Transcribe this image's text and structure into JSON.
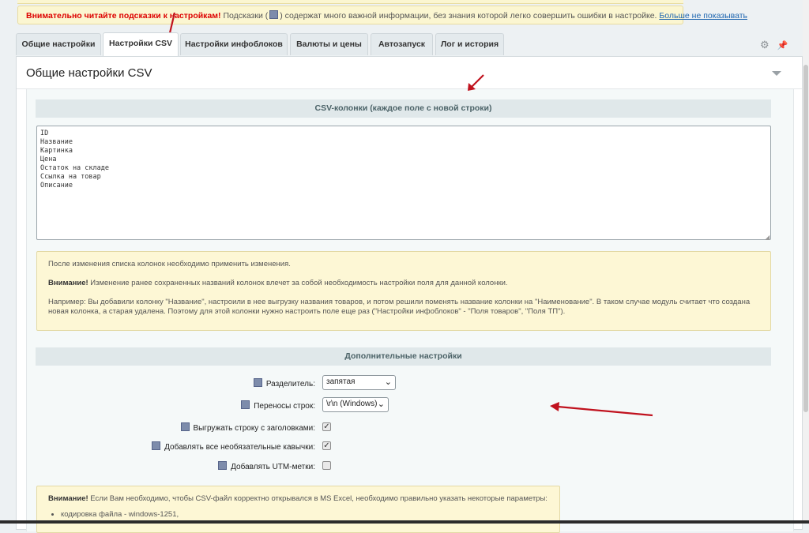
{
  "hint_banner": {
    "warning": "Внимательно читайте подсказки к настройкам!",
    "text_before_icon": "Подсказки (",
    "text_after_icon": ") содержат много важной информации, без знания которой легко совершить ошибки в настройке.",
    "link": "Больше не показывать"
  },
  "tabs": [
    {
      "label": "Общие настройки"
    },
    {
      "label": "Настройки CSV"
    },
    {
      "label": "Настройки инфоблоков"
    },
    {
      "label": "Валюты и цены"
    },
    {
      "label": "Автозапуск"
    },
    {
      "label": "Лог и история"
    }
  ],
  "tab_tools": {
    "settings_icon": "gear-icon",
    "pin_icon": "pin-icon"
  },
  "panel": {
    "title": "Общие настройки CSV",
    "csv_section_title": "CSV-колонки (каждое поле с новой строки)",
    "csv_columns": "ID\nНазвание\nКартинка\nЦена\nОстаток на складе\nСсылка на товар\nОписание",
    "note1": {
      "p1": "После изменения списка колонок необходимо применить изменения.",
      "p2_bold": "Внимание!",
      "p2": " Изменение ранее сохраненных названий колонок влечет за собой необходимость настройки поля для данной колонки.",
      "p3": "Например: Вы добавили колонку \"Название\", настроили в нее выгрузку названия товаров, и потом решили поменять название колонки на \"Наименование\". В таком случае модуль считает что создана новая колонка, а старая удалена. Поэтому для этой колонки нужно настроить поле еще раз (\"Настройки инфоблоков\" - \"Поля товаров\", \"Поля ТП\")."
    },
    "extra_section_title": "Дополнительные настройки",
    "fields": {
      "separator_label": "Разделитель:",
      "separator_value": "запятая",
      "linebreak_label": "Переносы строк:",
      "linebreak_value": "\\r\\n (Windows)",
      "headers_label": "Выгружать строку с заголовками:",
      "headers_checked": true,
      "quotes_label": "Добавлять все необязательные кавычки:",
      "quotes_checked": true,
      "utm_label": "Добавлять UTM-метки:",
      "utm_checked": false
    },
    "note2": {
      "bold": "Внимание!",
      "text": " Если Вам необходимо, чтобы CSV-файл корректно открывался в MS Excel, необходимо правильно указать некоторые параметры:",
      "item1": "кодировка файла - windows-1251,"
    }
  },
  "colors": {
    "annotation_arrow": "#c0121e",
    "warning_text": "#dd0000",
    "link": "#2067b0"
  }
}
